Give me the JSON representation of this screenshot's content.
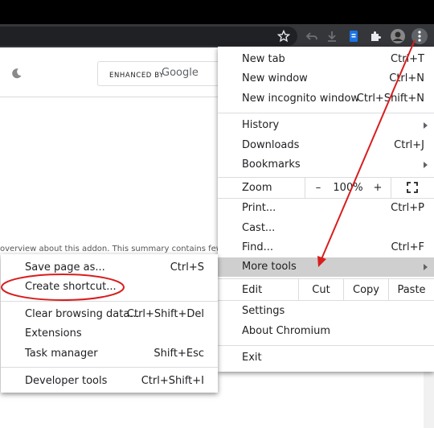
{
  "page": {
    "search_brand_prefix": "ENHANCED BY",
    "search_brand": "Google",
    "body_text": "overview about this addon. This summary contains few"
  },
  "main_menu": {
    "items": [
      {
        "label": "New tab",
        "shortcut": "Ctrl+T"
      },
      {
        "label": "New window",
        "shortcut": "Ctrl+N"
      },
      {
        "label": "New incognito window",
        "shortcut": "Ctrl+Shift+N"
      },
      {
        "label": "History",
        "shortcut": ""
      },
      {
        "label": "Downloads",
        "shortcut": "Ctrl+J"
      },
      {
        "label": "Bookmarks",
        "shortcut": ""
      }
    ],
    "zoom": {
      "label": "Zoom",
      "minus": "–",
      "value": "100%",
      "plus": "+"
    },
    "items2": [
      {
        "label": "Print...",
        "shortcut": "Ctrl+P"
      },
      {
        "label": "Cast...",
        "shortcut": ""
      },
      {
        "label": "Find...",
        "shortcut": "Ctrl+F"
      },
      {
        "label": "More tools",
        "shortcut": ""
      }
    ],
    "edit": {
      "label": "Edit",
      "cut": "Cut",
      "copy": "Copy",
      "paste": "Paste"
    },
    "items3": [
      {
        "label": "Settings"
      },
      {
        "label": "About Chromium"
      }
    ],
    "exit": "Exit"
  },
  "submenu": {
    "items": [
      {
        "label": "Save page as...",
        "shortcut": "Ctrl+S"
      },
      {
        "label": "Create shortcut...",
        "shortcut": ""
      },
      {
        "label": "Clear browsing data...",
        "shortcut": "Ctrl+Shift+Del"
      },
      {
        "label": "Extensions",
        "shortcut": ""
      },
      {
        "label": "Task manager",
        "shortcut": "Shift+Esc"
      },
      {
        "label": "Developer tools",
        "shortcut": "Ctrl+Shift+I"
      }
    ]
  },
  "colors": {
    "annotation": "#d81e1e",
    "highlight": "#cfcfcf",
    "toolbar": "#35363a"
  },
  "icons": [
    "star-icon",
    "back-icon",
    "download-icon",
    "doc-extension-icon",
    "puzzle-icon",
    "avatar",
    "kebab-menu-icon",
    "moon-icon",
    "fullscreen-icon"
  ]
}
